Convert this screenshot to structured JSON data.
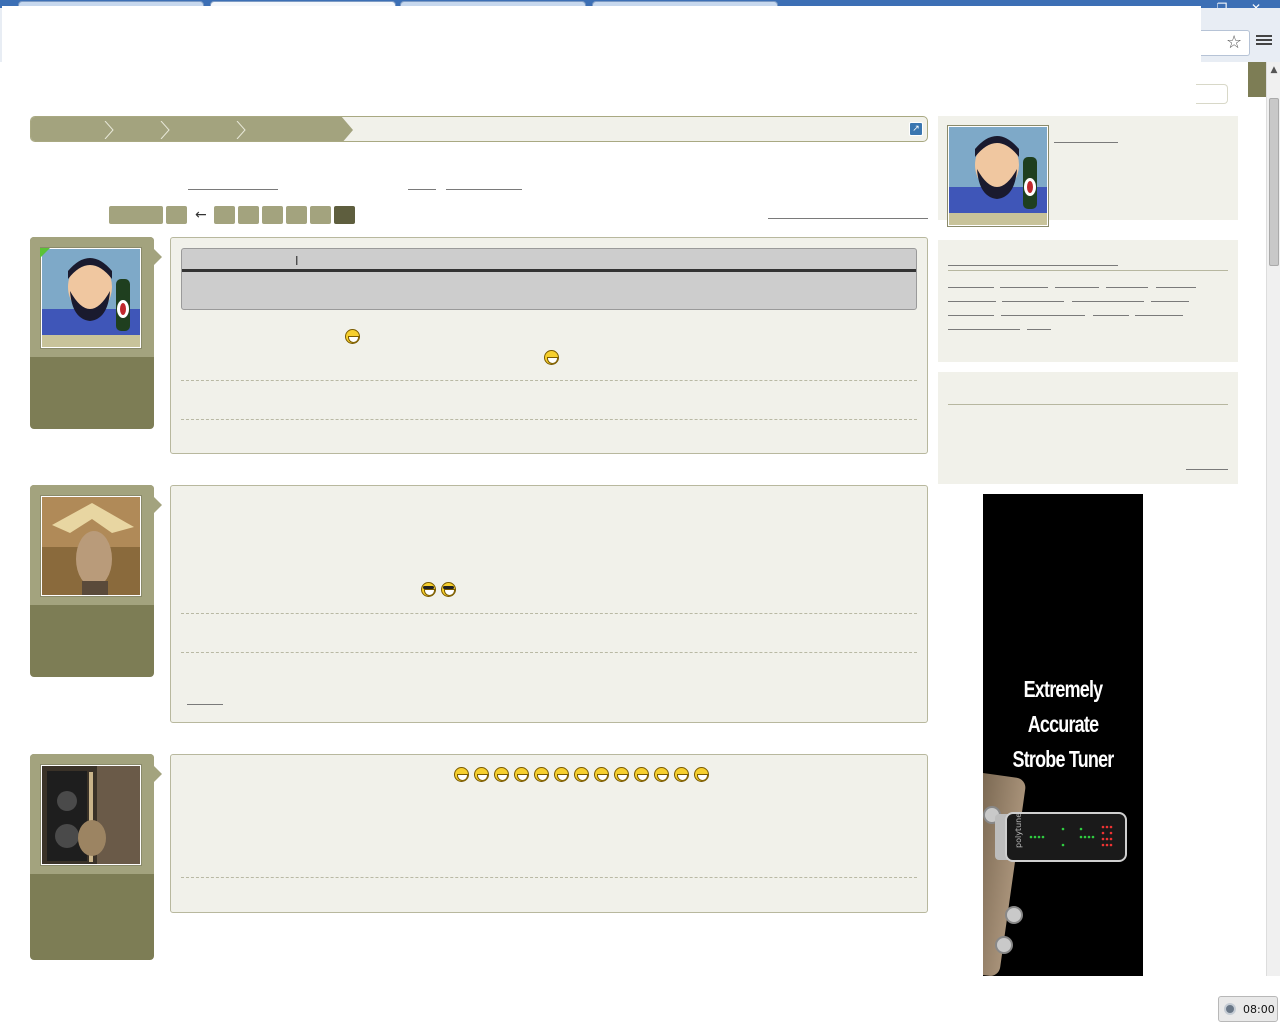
{
  "browser": {
    "window_buttons": [
      "—",
      "❐",
      "✕"
    ],
    "star_icon": "☆"
  },
  "breadcrumb": {
    "expand_icon": "↗"
  },
  "pagination": {
    "arrow": "←"
  },
  "posts": [
    {
      "quote_marker": "I",
      "emoji_icon": "grin-icon"
    },
    {
      "emoji_icon": "cool-icon"
    },
    {
      "emoji_icon": "grin-icon"
    }
  ],
  "ad": {
    "headline": "Extremely Accurate Strobe Tuner",
    "brand": "polytune"
  },
  "taskbar": {
    "time": "08:00"
  },
  "colors": {
    "olive_dark": "#7d7d55",
    "olive_light": "#a3a37e",
    "panel_bg": "#f1f1ea"
  }
}
